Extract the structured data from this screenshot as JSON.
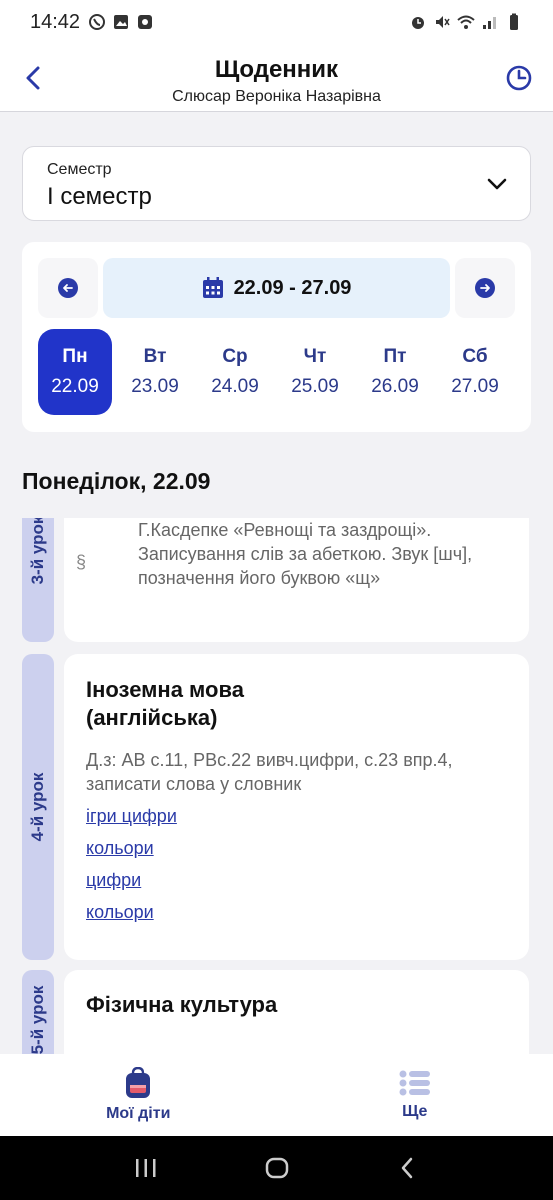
{
  "status_bar": {
    "time": "14:42"
  },
  "header": {
    "title": "Щоденник",
    "subtitle": "Слюсар Вероніка Назарівна"
  },
  "semester": {
    "label": "Семестр",
    "value": "І семестр"
  },
  "week": {
    "range": "22.09 - 27.09",
    "days": [
      {
        "name": "Пн",
        "date": "22.09",
        "active": true
      },
      {
        "name": "Вт",
        "date": "23.09",
        "active": false
      },
      {
        "name": "Ср",
        "date": "24.09",
        "active": false
      },
      {
        "name": "Чт",
        "date": "25.09",
        "active": false
      },
      {
        "name": "Пт",
        "date": "26.09",
        "active": false
      },
      {
        "name": "Сб",
        "date": "27.09",
        "active": false
      }
    ]
  },
  "day_heading": "Понеділок, 22.09",
  "lessons": [
    {
      "number": "3-й урок",
      "text": "Г.Касдепке «Ревнощі та заздрощі». Записування слів за абеткою. Звук [шч], позначення  його буквою «щ»"
    },
    {
      "number": "4-й урок",
      "subject": "Іноземна мова (англійська)",
      "homework": "Д.з: АВ с.11, РВс.22 вивч.цифри, с.23 впр.4, записати слова у словник",
      "links": [
        "ігри цифри",
        "кольори",
        "цифри",
        "кольори"
      ]
    },
    {
      "number": "5-й урок",
      "subject": "Фізична культура"
    }
  ],
  "bottom_nav": {
    "my_children": "Мої діти",
    "more": "Ще"
  },
  "colors": {
    "accent": "#2134c9",
    "link": "#2a3aa8",
    "tag_bg": "#ccd0ee",
    "range_bg": "#e6f1fb"
  }
}
